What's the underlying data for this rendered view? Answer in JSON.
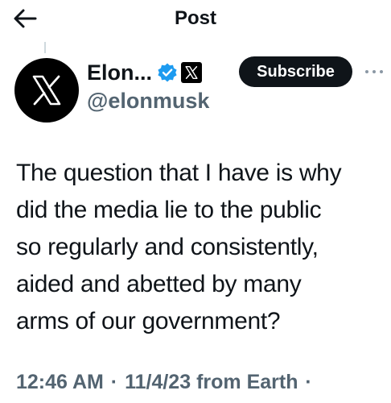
{
  "header": {
    "title": "Post",
    "back_icon": "arrow-left-icon"
  },
  "author": {
    "display_name": "Elon...",
    "handle": "@elonmusk",
    "avatar_icon": "x-logo-icon",
    "verified_icon": "verified-badge-icon",
    "affiliation_icon": "x-logo-icon",
    "badge_color": "#1d9bf0"
  },
  "actions": {
    "subscribe_label": "Subscribe",
    "more_icon": "more-dots-icon"
  },
  "tweet": {
    "lines": [
      "The question that I have is why",
      "did the media lie to the public",
      "so regularly and consistently,",
      "aided and abetted by many",
      "arms of our government?"
    ]
  },
  "meta": {
    "time": "12:46 AM",
    "separator": "·",
    "date": "11/4/23",
    "source": "from Earth",
    "trailing_separator": "·"
  }
}
